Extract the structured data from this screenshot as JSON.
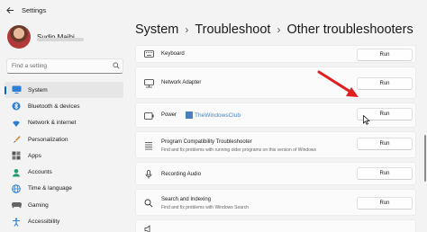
{
  "window": {
    "title": "Settings"
  },
  "user": {
    "name": "Sudip Majhi"
  },
  "search": {
    "placeholder": "Find a setting"
  },
  "nav": [
    {
      "label": "System",
      "icon": "monitor-icon",
      "active": true
    },
    {
      "label": "Bluetooth & devices",
      "icon": "bluetooth-icon"
    },
    {
      "label": "Network & internet",
      "icon": "wifi-icon"
    },
    {
      "label": "Personalization",
      "icon": "brush-icon"
    },
    {
      "label": "Apps",
      "icon": "apps-icon"
    },
    {
      "label": "Accounts",
      "icon": "person-icon"
    },
    {
      "label": "Time & language",
      "icon": "globe-icon"
    },
    {
      "label": "Gaming",
      "icon": "gamepad-icon"
    },
    {
      "label": "Accessibility",
      "icon": "accessibility-icon"
    }
  ],
  "breadcrumb": {
    "level1": "System",
    "level2": "Troubleshoot",
    "current": "Other troubleshooters"
  },
  "troubleshooters": [
    {
      "title": "Keyboard",
      "description": "",
      "icon": "keyboard-icon",
      "button": "Run"
    },
    {
      "title": "Network Adapter",
      "description": "",
      "icon": "network-adapter-icon",
      "button": "Run"
    },
    {
      "title": "Power",
      "description": "",
      "icon": "power-icon",
      "button": "Run"
    },
    {
      "title": "Program Compatibility Troubleshooter",
      "description": "Find and fix problems with running older programs on this version of Windows",
      "icon": "list-icon",
      "button": "Run"
    },
    {
      "title": "Recording Audio",
      "description": "",
      "icon": "microphone-icon",
      "button": "Run"
    },
    {
      "title": "Search and Indexing",
      "description": "Find and fix problems with Windows Search",
      "icon": "search-icon",
      "button": "Run"
    }
  ],
  "watermark": "TheWindowsClub",
  "colors": {
    "accent": "#0067c0",
    "arrow": "#e02020"
  }
}
